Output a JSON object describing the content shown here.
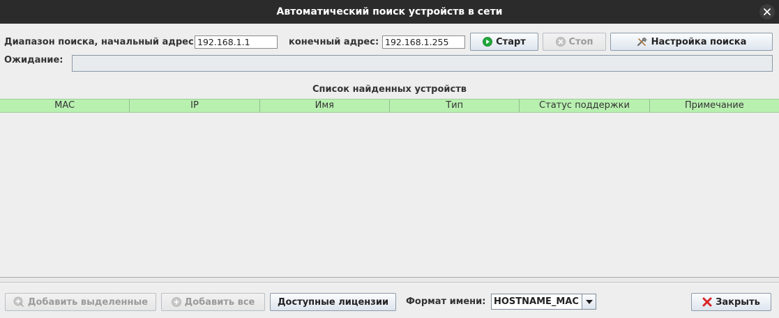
{
  "window": {
    "title": "Автоматический поиск устройств в сети"
  },
  "search": {
    "start_label": "Диапазон поиска, начальный адрес:",
    "start_value": "192.168.1.1",
    "end_label": "конечный адрес:",
    "end_value": "192.168.1.255",
    "start_button": "Старт",
    "stop_button": "Стоп",
    "settings_button": "Настройка поиска",
    "waiting_label": "Ожидание:",
    "progress": 0
  },
  "devices": {
    "title": "Список найденных устройств",
    "columns": [
      "MAC",
      "IP",
      "Имя",
      "Тип",
      "Статус поддержки",
      "Примечание"
    ],
    "rows": []
  },
  "footer": {
    "add_selected_button": "Добавить выделенные",
    "add_all_button": "Добавить все",
    "licenses_button": "Доступные лицензии",
    "name_format_label": "Формат имени:",
    "name_format_value": "HOSTNAME_MAC",
    "close_button": "Закрыть"
  },
  "colors": {
    "titlebar": "#2b2b2b",
    "table_header": "#b8f0b0",
    "start_icon": "#1fa83a",
    "close_icon": "#d8262a"
  }
}
